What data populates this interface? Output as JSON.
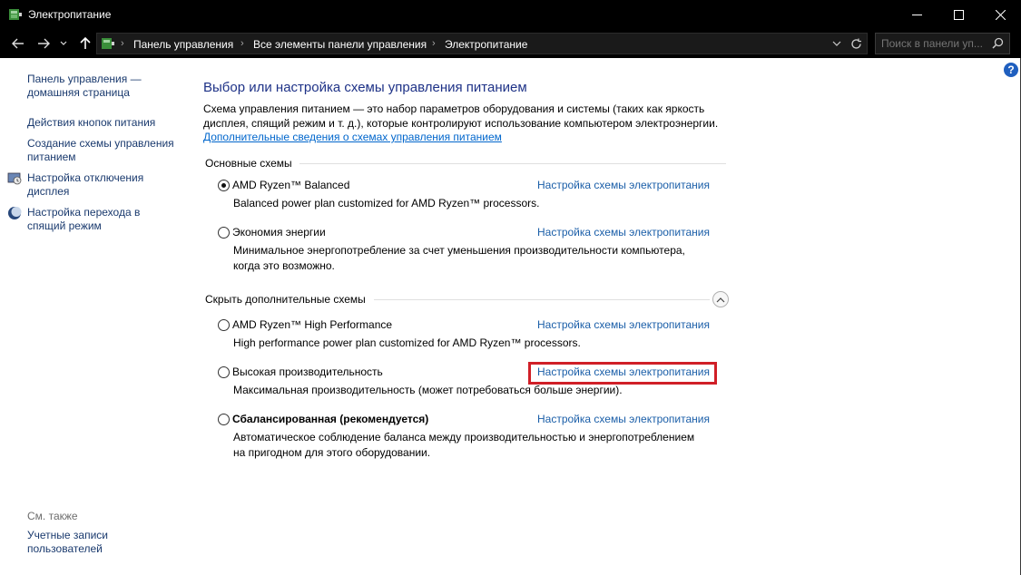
{
  "window": {
    "title": "Электропитание",
    "controls": {
      "minimize": "minimize-icon",
      "maximize": "maximize-icon",
      "close": "close-icon"
    }
  },
  "navigation": {
    "breadcrumbs": [
      "Панель управления",
      "Все элементы панели управления",
      "Электропитание"
    ],
    "search_placeholder": "Поиск в панели уп..."
  },
  "sidebar": {
    "links": [
      {
        "label_line1": "Панель управления —",
        "label_line2": "домашняя страница"
      },
      {
        "label_line1": "Действия кнопок питания"
      },
      {
        "label_line1": "Создание схемы управления",
        "label_line2": "питанием"
      },
      {
        "label_line1": "Настройка отключения",
        "label_line2": "дисплея",
        "icon": "display-icon"
      },
      {
        "label_line1": "Настройка перехода в",
        "label_line2": "спящий режим",
        "icon": "moon-icon"
      }
    ],
    "see_also": {
      "heading": "См. также",
      "links": [
        {
          "label_line1": "Учетные записи",
          "label_line2": "пользователей"
        }
      ]
    }
  },
  "main": {
    "title": "Выбор или настройка схемы управления питанием",
    "description_line1": "Схема управления питанием — это набор параметров оборудования и системы (таких как яркость",
    "description_line2": "дисплея, спящий режим и т. д.), которые контролируют использование компьютером электроэнергии.",
    "more_info_link": "Дополнительные сведения о схемах управления питанием",
    "primary_section": "Основные схемы",
    "hidden_section": "Скрыть дополнительные схемы",
    "plans": [
      {
        "name": "AMD Ryzen™ Balanced",
        "desc1": "Balanced power plan customized for AMD Ryzen™ processors.",
        "link": "Настройка схемы электропитания",
        "selected": true
      },
      {
        "name": "Экономия энергии",
        "desc1": "Минимальное энергопотребление за счет уменьшения производительности компьютера,",
        "desc2": "когда это возможно.",
        "link": "Настройка схемы электропитания",
        "selected": false
      },
      {
        "name": "AMD Ryzen™ High Performance",
        "desc1": "High performance power plan customized for AMD Ryzen™ processors.",
        "link": "Настройка схемы электропитания",
        "selected": false
      },
      {
        "name": "Высокая производительность",
        "desc1": "Максимальная производительность (может потребоваться больше энергии).",
        "link": "Настройка схемы электропитания",
        "selected": false,
        "highlighted": true
      },
      {
        "name": "Сбалансированная (рекомендуется)",
        "desc1": "Автоматическое соблюдение баланса между производительностью и энергопотреблением",
        "desc2": "на пригодном для этого оборудовании.",
        "link": "Настройка схемы электропитания",
        "selected": false
      }
    ],
    "help_label": "?"
  },
  "colors": {
    "accent_title": "#1e3287",
    "link": "#1a5ea8",
    "highlight_box": "#d01f27",
    "titlebar": "#000000"
  }
}
